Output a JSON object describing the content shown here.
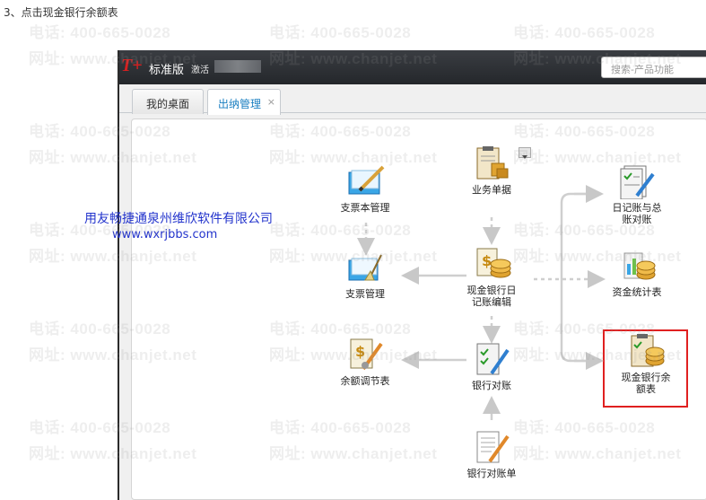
{
  "instruction": "3、点击现金银行余额表",
  "watermark": {
    "phone": "电话: 400-665-0028",
    "site": "网址: www.chanjet.net"
  },
  "app": {
    "logo": "T+",
    "edition": "标准版",
    "activate": "激活",
    "search_placeholder": "搜索-产品功能"
  },
  "tabs": [
    {
      "label": "我的桌面",
      "active": false
    },
    {
      "label": "出纳管理",
      "active": true,
      "close": "×"
    }
  ],
  "flow": {
    "check_book": "支票本管理",
    "business_docs": "业务单据",
    "journal_total": [
      "日记账与总",
      "账对账"
    ],
    "check_mgmt": "支票管理",
    "cash_bank_journal": [
      "现金银行日",
      "记账编辑"
    ],
    "fund_stats": "资金统计表",
    "balance_adjust": "余额调节表",
    "bank_reconcile": "银行对账",
    "cash_bank_balance": [
      "现金银行余",
      "额表"
    ],
    "bank_statement": "银行对账单"
  },
  "overlay": {
    "company": "用友畅捷通泉州维欣软件有限公司",
    "site": "www.wxrjbbs.com"
  },
  "colors": {
    "accent": "#1a7fc1",
    "highlight": "#e02020",
    "overlay_text": "#2233cc",
    "logo": "#d62020"
  }
}
